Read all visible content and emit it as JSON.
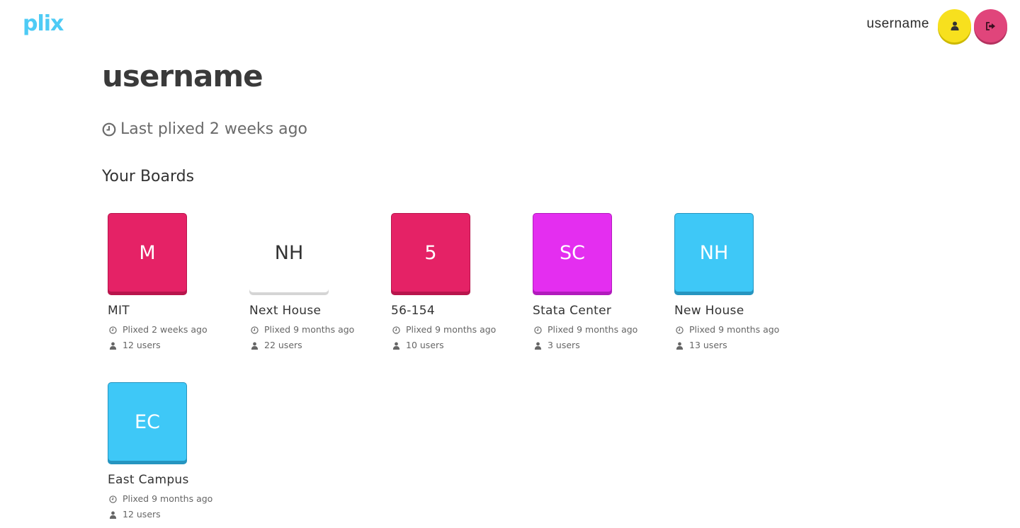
{
  "app": {
    "logo": "plix"
  },
  "header": {
    "username": "username",
    "profile_icon": "user-icon",
    "logout_icon": "sign-out-icon",
    "colors": {
      "profile": "#f7e01e",
      "logout": "#e0457b"
    }
  },
  "profile": {
    "title": "username",
    "last_plixed": "Last plixed 2 weeks ago"
  },
  "boards_section": {
    "title": "Your Boards"
  },
  "boards": [
    {
      "initials": "M",
      "name": "MIT",
      "plixed": "Plixed 2 weeks ago",
      "users": "12 users",
      "color": "#e52266",
      "border": "#b8154c"
    },
    {
      "initials": "NH",
      "name": "Next House",
      "plixed": "Plixed 9 months ago",
      "users": "22 users",
      "color": "#ffffff",
      "border": "#d5d5d5"
    },
    {
      "initials": "5",
      "name": "56-154",
      "plixed": "Plixed 9 months ago",
      "users": "10 users",
      "color": "#e52266",
      "border": "#b8154c"
    },
    {
      "initials": "SC",
      "name": "Stata Center",
      "plixed": "Plixed 9 months ago",
      "users": "3 users",
      "color": "#e42ef0",
      "border": "#b21bbd"
    },
    {
      "initials": "NH",
      "name": "New House",
      "plixed": "Plixed 9 months ago",
      "users": "13 users",
      "color": "#3ec8f7",
      "border": "#2695c0"
    },
    {
      "initials": "EC",
      "name": "East Campus",
      "plixed": "Plixed 9 months ago",
      "users": "12 users",
      "color": "#3ec8f7",
      "border": "#2695c0"
    }
  ]
}
